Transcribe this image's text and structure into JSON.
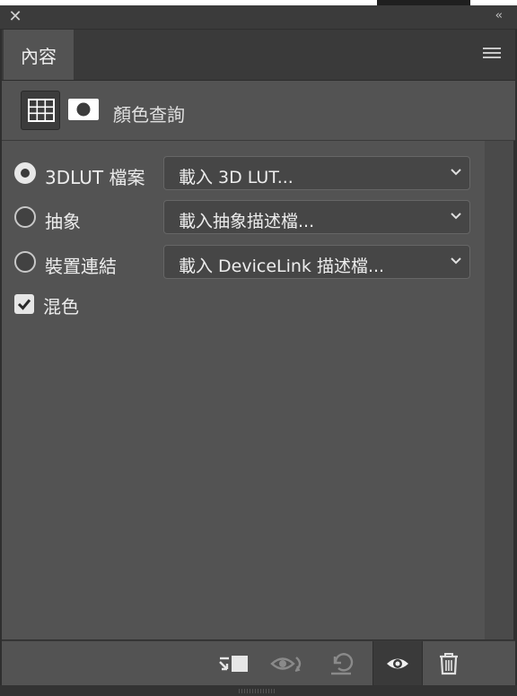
{
  "window": {
    "collapse_glyph": "‹‹",
    "close_glyph": "✕"
  },
  "tabs": [
    {
      "label": "內容"
    }
  ],
  "adjustment": {
    "label": "顏色查詢"
  },
  "rows": [
    {
      "label": "3DLUT 檔案",
      "selected": true,
      "value": "載入 3D LUT..."
    },
    {
      "label": "抽象",
      "selected": false,
      "value": "載入抽象描述檔..."
    },
    {
      "label": "裝置連結",
      "selected": false,
      "value": "載入 DeviceLink 描述檔..."
    }
  ],
  "dither": {
    "label": "混色",
    "checked": true
  },
  "footer_icons": [
    "clip-to-layer-icon",
    "view-previous-state-icon",
    "reset-icon",
    "visibility-eye-icon",
    "trash-icon"
  ]
}
